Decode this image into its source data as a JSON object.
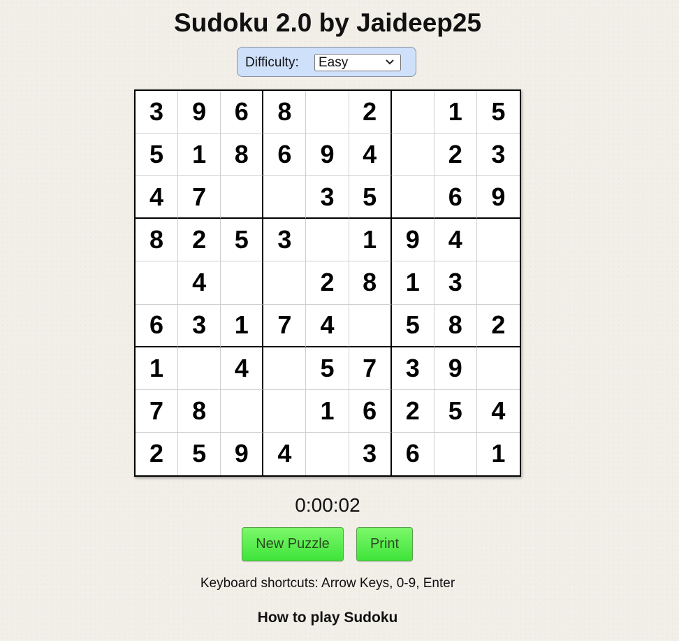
{
  "header": {
    "title": "Sudoku 2.0 by Jaideep25"
  },
  "difficulty": {
    "label": "Difficulty:",
    "selected": "Easy"
  },
  "board": {
    "cells": [
      [
        "3",
        "9",
        "6",
        "8",
        "",
        "2",
        "",
        "1",
        "5"
      ],
      [
        "5",
        "1",
        "8",
        "6",
        "9",
        "4",
        "",
        "2",
        "3"
      ],
      [
        "4",
        "7",
        "",
        "",
        "3",
        "5",
        "",
        "6",
        "9"
      ],
      [
        "8",
        "2",
        "5",
        "3",
        "",
        "1",
        "9",
        "4",
        ""
      ],
      [
        "",
        "4",
        "",
        "",
        "2",
        "8",
        "1",
        "3",
        ""
      ],
      [
        "6",
        "3",
        "1",
        "7",
        "4",
        "",
        "5",
        "8",
        "2"
      ],
      [
        "1",
        "",
        "4",
        "",
        "5",
        "7",
        "3",
        "9",
        ""
      ],
      [
        "7",
        "8",
        "",
        "",
        "1",
        "6",
        "2",
        "5",
        "4"
      ],
      [
        "2",
        "5",
        "9",
        "4",
        "",
        "3",
        "6",
        "",
        "1"
      ]
    ]
  },
  "timer": {
    "value": "0:00:02"
  },
  "buttons": {
    "new_puzzle": "New Puzzle",
    "print": "Print"
  },
  "footer": {
    "shortcuts": "Keyboard shortcuts: Arrow Keys, 0-9, Enter",
    "how_to_play": "How to play Sudoku"
  },
  "colors": {
    "background": "#f2efe9",
    "difficulty_box": "#cfe0fb",
    "button_green": "#3fe43a"
  },
  "icons": {
    "select_arrow": "chevron-down-icon"
  }
}
